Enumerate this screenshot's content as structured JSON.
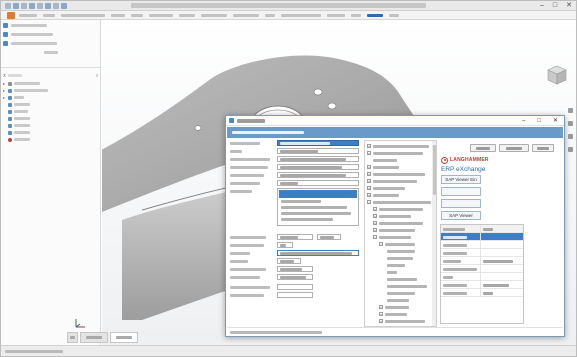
{
  "window": {
    "controls": [
      "–",
      "□",
      "✕"
    ]
  },
  "ribbon": {
    "tabs": [
      "",
      "",
      "",
      "",
      "",
      "",
      "",
      "",
      "",
      "",
      "",
      "",
      "",
      "",
      ""
    ],
    "active_index": 13
  },
  "panel": {
    "tools": [
      "",
      ""
    ],
    "tree": [
      {
        "label": "",
        "icon": "gray"
      },
      {
        "label": "",
        "icon": "blue"
      },
      {
        "label": "",
        "icon": "blue"
      },
      {
        "label": "",
        "icon": "blue"
      },
      {
        "label": "",
        "icon": "blue"
      },
      {
        "label": "",
        "icon": "blue"
      },
      {
        "label": "",
        "icon": "blue"
      },
      {
        "label": "",
        "icon": "blue"
      },
      {
        "label": "",
        "icon": "red"
      }
    ]
  },
  "dialog": {
    "title": "",
    "header": "",
    "controls": [
      "–",
      "□",
      "✕"
    ],
    "form": [
      {
        "label": "",
        "value": ""
      },
      {
        "label": "",
        "value": ""
      },
      {
        "label": "",
        "value": ""
      },
      {
        "label": "",
        "value": ""
      },
      {
        "label": "",
        "value": ""
      },
      {
        "label": "",
        "value": ""
      }
    ],
    "tree": [],
    "buttons": [
      "",
      "",
      ""
    ],
    "brand": "LANGHAMMER",
    "erp_title": "ERP eXchange",
    "sap_buttons": [
      "SAP Viewer Ein",
      "",
      "",
      "SAP Viewer"
    ],
    "props": [],
    "status": ""
  },
  "statusbar": {
    "text": ""
  },
  "doc_tabs": [
    "",
    ""
  ]
}
